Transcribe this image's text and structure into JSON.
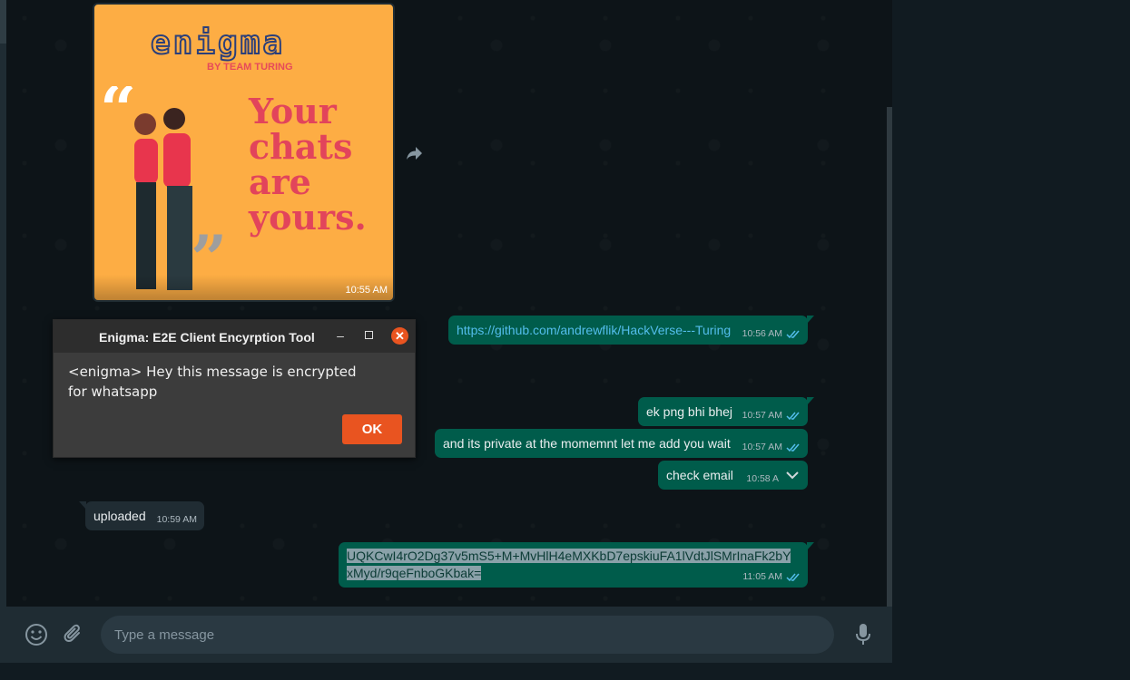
{
  "image_message": {
    "logo": "enigma",
    "byline": "BY TEAM TURING",
    "headline": "Your chats are yours.",
    "time": "10:55 AM"
  },
  "messages": [
    {
      "text": "https://github.com/andrewflik/HackVerse---Turing",
      "time": "10:56 AM"
    },
    {
      "text": "ek png bhi bhej",
      "time": "10:57 AM"
    },
    {
      "text": "and its private at the momemnt let me add you wait",
      "time": "10:57 AM"
    },
    {
      "text": "check email",
      "time": "10:58 A"
    },
    {
      "text": "uploaded",
      "time": "10:59 AM"
    },
    {
      "line1": "UQKCwI4rO2Dg37v5mS5+M+MvHlH4eMXKbD7epskiuFA1lVdtJlSMrInaFk2bY",
      "line2": "xMyd/r9qeFnboGKbak=",
      "time": "11:05 AM"
    }
  ],
  "dialog": {
    "title": "Enigma: E2E Client Encyrption Tool",
    "message": "<enigma> Hey this message is encrypted for whatsapp",
    "ok_label": "OK",
    "minimize": "–",
    "close": "✕"
  },
  "composer": {
    "placeholder": "Type a message"
  },
  "colors": {
    "outgoing_bubble": "#005c4b",
    "incoming_bubble": "#202c33",
    "accent_orange": "#e95420",
    "tick_blue": "#53bdeb"
  }
}
